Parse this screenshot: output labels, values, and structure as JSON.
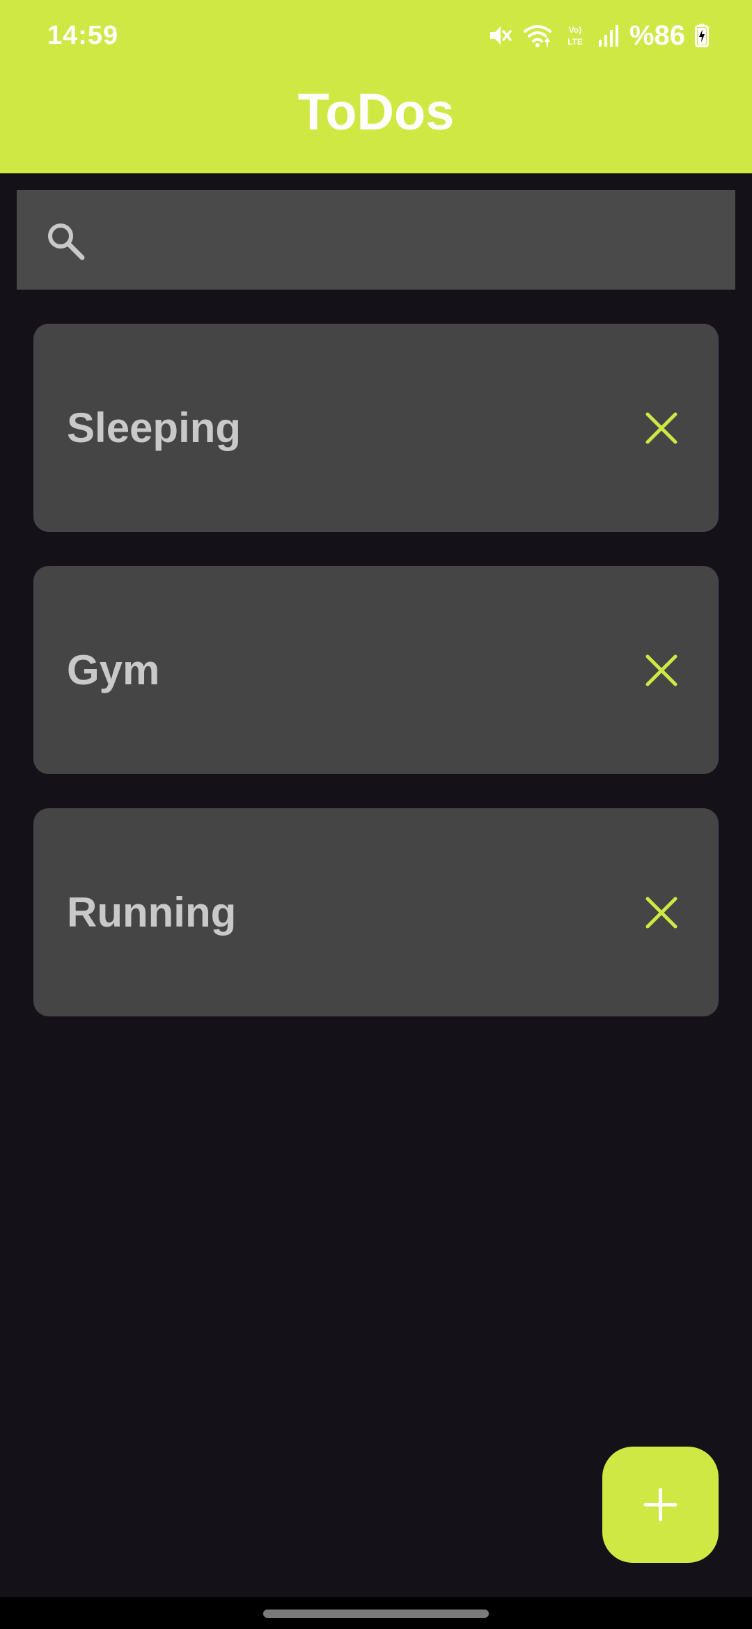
{
  "status_bar": {
    "time": "14:59",
    "battery": "%86",
    "network_label": "Vo) LTE"
  },
  "app": {
    "title": "ToDos"
  },
  "search": {
    "value": "",
    "placeholder": ""
  },
  "todos": [
    {
      "label": "Sleeping"
    },
    {
      "label": "Gym"
    },
    {
      "label": "Running"
    }
  ],
  "colors": {
    "accent": "#cfe843",
    "background": "#141218",
    "card": "#454545",
    "search_bar": "#4a4a4a",
    "label_text": "#c9c9c9"
  },
  "icons": {
    "search": "search-icon",
    "delete": "close-icon",
    "add": "plus-icon",
    "mute": "mute-icon",
    "wifi": "wifi-icon",
    "signal": "signal-icon",
    "battery": "battery-charging-icon"
  }
}
